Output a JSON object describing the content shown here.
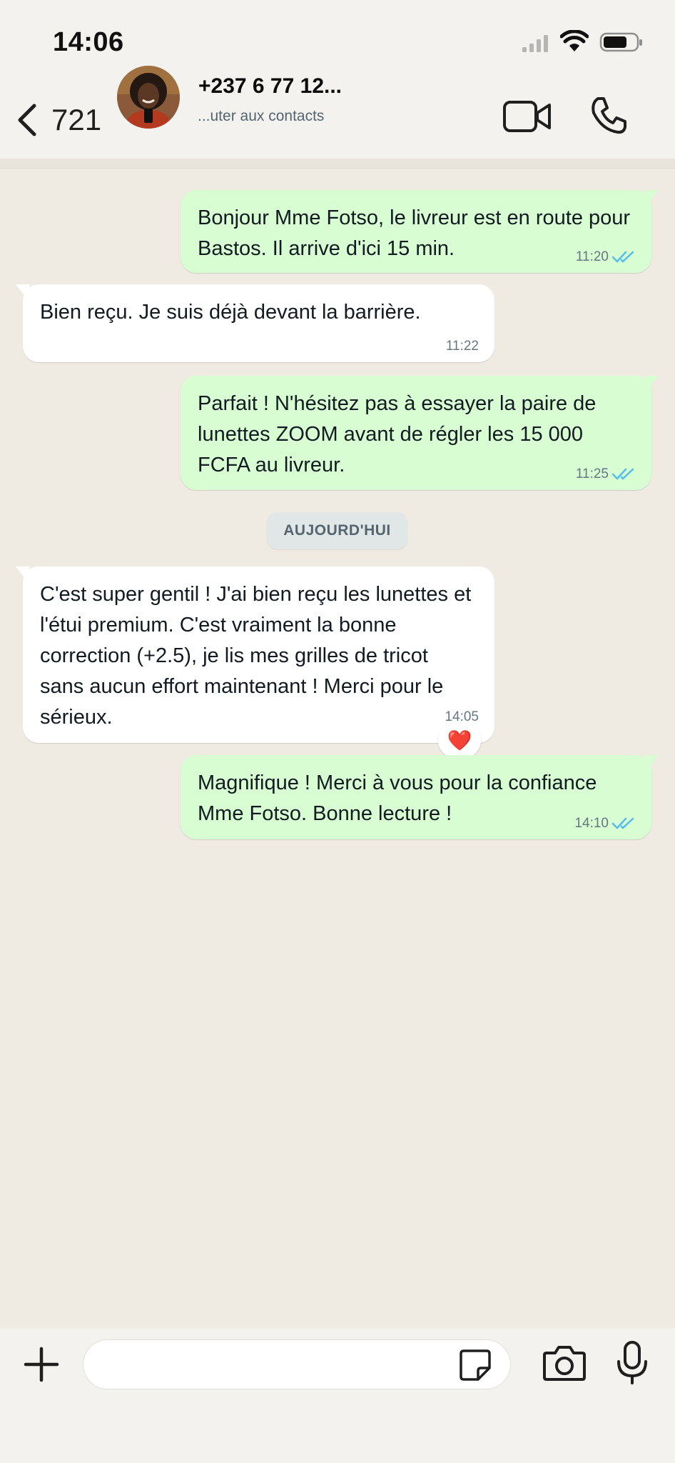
{
  "status_bar": {
    "time": "14:06"
  },
  "header": {
    "back_count": "721",
    "contact_name": "+237 6 77 12...",
    "contact_subtitle": "...uter aux contacts"
  },
  "messages": [
    {
      "direction": "out",
      "text": "Bonjour Mme Fotso, le livreur est en route pour Bastos. Il arrive d'ici 15 min.",
      "time": "11:20"
    },
    {
      "direction": "in",
      "text": "Bien reçu. Je suis déjà devant la barrière.",
      "time": "11:22"
    },
    {
      "direction": "out",
      "text": "Parfait ! N'hésitez pas à essayer la paire de lunettes ZOOM avant de régler les 15 000 FCFA au livreur.",
      "time": "11:25"
    },
    {
      "direction": "in",
      "text": "C'est super gentil ! J'ai bien reçu les lunettes et l'étui premium. C'est vraiment la bonne correction (+2.5), je lis mes grilles de tricot sans aucun effort maintenant ! Merci pour le sérieux.",
      "time": "14:05",
      "reaction": "❤️"
    },
    {
      "direction": "out",
      "text": "Magnifique ! Merci à vous pour la confiance Mme Fotso. Bonne lecture !",
      "time": "14:10"
    }
  ],
  "date_separator": "AUJOURD'HUI",
  "composer": {
    "value": "",
    "placeholder": ""
  },
  "colors": {
    "outgoing_bubble": "#d9fdd3",
    "incoming_bubble": "#ffffff",
    "chat_background": "#efeae2",
    "read_ticks": "#53bdeb"
  }
}
